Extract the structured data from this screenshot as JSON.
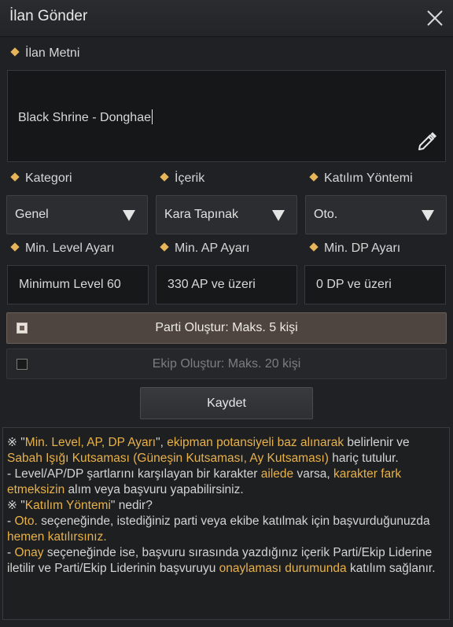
{
  "window": {
    "title": "İlan Gönder"
  },
  "ad_text": {
    "label": "İlan Metni",
    "value": "Black Shrine - Donghae"
  },
  "category": {
    "label": "Kategori",
    "value": "Genel"
  },
  "content": {
    "label": "İçerik",
    "value": "Kara Tapınak"
  },
  "join_method": {
    "label": "Katılım Yöntemi",
    "value": "Oto."
  },
  "min_level": {
    "label": "Min. Level Ayarı",
    "value": "Minimum Level 60"
  },
  "min_ap": {
    "label": "Min. AP Ayarı",
    "value": "330 AP ve üzeri"
  },
  "min_dp": {
    "label": "Min. DP Ayarı",
    "value": "0 DP ve üzeri"
  },
  "party_option": {
    "label": "Parti Oluştur: Maks. 5 kişi",
    "checked": true
  },
  "squad_option": {
    "label": "Ekip Oluştur: Maks. 20 kişi",
    "checked": false
  },
  "save_button": {
    "label": "Kaydet"
  },
  "info": {
    "p1": [
      "※ \"",
      "Min. Level, AP, DP Ayarı",
      "\", ",
      "ekipman potansiyeli baz alınarak",
      " belirlenir ve ",
      "Sabah Işığı Kutsaması (Güneşin Kutsaması, Ay Kutsaması)",
      " hariç tutulur."
    ],
    "p2": [
      "- Level/AP/DP şartlarını karşılayan bir karakter ",
      "ailede",
      " varsa, ",
      "karakter fark etmeksizin",
      " alım veya başvuru yapabilirsiniz."
    ],
    "p3": [
      "※ \"",
      "Katılım Yöntemi",
      "\" nedir?"
    ],
    "p4": [
      "- ",
      "Oto.",
      " seçeneğinde, istediğiniz parti veya ekibe katılmak için başvurduğunuzda ",
      "hemen katılırsınız."
    ],
    "p5": [
      "- ",
      "Onay",
      " seçeneğinde ise, başvuru sırasında yazdığınız içerik Parti/Ekip Liderine iletilir ve Parti/Ekip Liderinin başvuruyu ",
      "onaylaması durumunda",
      " katılım sağlanır."
    ]
  },
  "colors": {
    "accent": "#e8b14a",
    "diamond": "#e8b45a",
    "background": "#202124"
  }
}
